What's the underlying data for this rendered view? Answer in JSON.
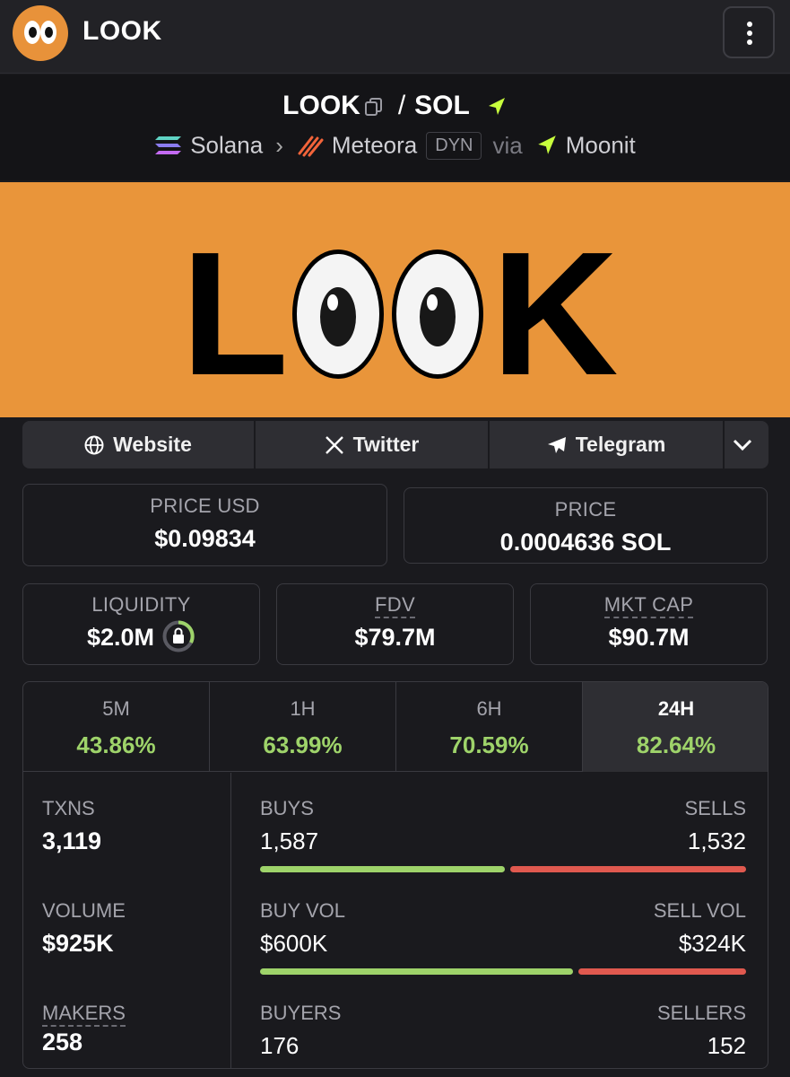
{
  "header": {
    "brand": "LOOK",
    "menu_icon": "kebab-menu-icon"
  },
  "pair": {
    "base": "LOOK",
    "separator": "/",
    "quote": "SOL",
    "chain": "Solana",
    "dex": "Meteora",
    "pool_type": "DYN",
    "via_label": "via",
    "launchpad": "Moonit",
    "accent_color": "#c8ff3d"
  },
  "banner": {
    "text_l": "L",
    "text_k": "K",
    "bg_color": "#e9953a"
  },
  "links": {
    "website": "Website",
    "twitter": "Twitter",
    "telegram": "Telegram"
  },
  "price": {
    "usd_label": "PRICE USD",
    "usd_value": "$0.09834",
    "native_label": "PRICE",
    "native_value": "0.0004636 SOL"
  },
  "metrics": {
    "liquidity_label": "LIQUIDITY",
    "liquidity_value": "$2.0M",
    "fdv_label": "FDV",
    "fdv_value": "$79.7M",
    "mcap_label": "MKT CAP",
    "mcap_value": "$90.7M"
  },
  "timeframes": [
    {
      "label": "5M",
      "change": "43.86%"
    },
    {
      "label": "1H",
      "change": "63.99%"
    },
    {
      "label": "6H",
      "change": "70.59%"
    },
    {
      "label": "24H",
      "change": "82.64%",
      "active": true
    }
  ],
  "stats": {
    "txns_label": "TXNS",
    "txns": "3,119",
    "volume_label": "VOLUME",
    "volume": "$925K",
    "makers_label": "MAKERS",
    "makers": "258",
    "buys_label": "BUYS",
    "buys": "1,587",
    "sells_label": "SELLS",
    "sells": "1,532",
    "buys_fraction": 0.509,
    "buy_vol_label": "BUY VOL",
    "buy_vol": "$600K",
    "sell_vol_label": "SELL VOL",
    "sell_vol": "$324K",
    "buy_vol_fraction": 0.649,
    "buyers_label": "BUYERS",
    "buyers": "176",
    "sellers_label": "SELLERS",
    "sellers": "152"
  },
  "colors": {
    "positive": "#9ed36a",
    "negative": "#e0594f",
    "brand_orange": "#e9953a"
  }
}
